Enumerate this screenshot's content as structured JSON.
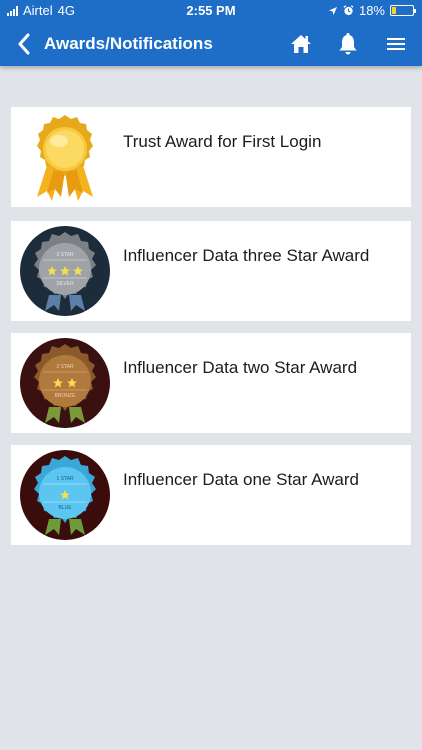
{
  "status": {
    "carrier": "Airtel",
    "network": "4G",
    "time": "2:55 PM",
    "battery": "18%",
    "battery_level": 0.18
  },
  "header": {
    "title": "Awards/Notifications"
  },
  "awards": [
    {
      "title": "Trust Award for First Login",
      "kind": "gold-ribbon"
    },
    {
      "title": "Influencer Data three Star Award",
      "kind": "silver",
      "stars": 3,
      "medal_top_text": "3 STAR",
      "medal_bottom_text": "SILVER"
    },
    {
      "title": "Influencer Data two Star Award",
      "kind": "bronze",
      "stars": 2,
      "medal_top_text": "2 STAR",
      "medal_bottom_text": "BRONZE"
    },
    {
      "title": "Influencer Data one Star Award",
      "kind": "blue",
      "stars": 1,
      "medal_top_text": "1 STAR",
      "medal_bottom_text": "BLUE"
    }
  ],
  "colors": {
    "primary": "#1e6ec8",
    "background": "#e0e3e8",
    "silver": "#9fa3a8",
    "bronze": "#b0793e",
    "blue": "#5cc6f1",
    "star": "#f7e04a"
  }
}
